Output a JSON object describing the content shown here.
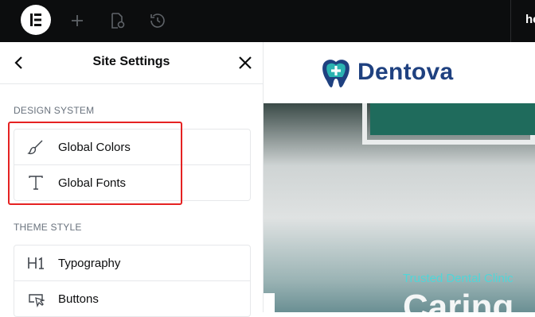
{
  "topbar": {
    "logo_icon": "elementor-logo-icon",
    "add_icon": "plus-icon",
    "page_settings_icon": "page-settings-icon",
    "history_icon": "history-icon",
    "right_text": "he"
  },
  "panel": {
    "title": "Site Settings",
    "back_icon": "chevron-left-icon",
    "close_icon": "close-icon",
    "design_system": {
      "label": "DESIGN SYSTEM",
      "items": [
        {
          "label": "Global Colors",
          "icon": "brush-icon"
        },
        {
          "label": "Global Fonts",
          "icon": "font-t-icon"
        }
      ]
    },
    "theme_style": {
      "label": "THEME STYLE",
      "items": [
        {
          "label": "Typography",
          "icon": "heading-h1-icon"
        },
        {
          "label": "Buttons",
          "icon": "button-pointer-icon"
        }
      ]
    }
  },
  "preview": {
    "brand": "Dentova",
    "hero_tagline": "Trusted Dental Clinic",
    "hero_heading": "Caring"
  },
  "colors": {
    "topbar_bg": "#0c0d0e",
    "highlight": "#e52222",
    "brand_blue": "#1f4180",
    "brand_teal": "#2bb3b1",
    "hero_tag": "#4fd6d8"
  }
}
